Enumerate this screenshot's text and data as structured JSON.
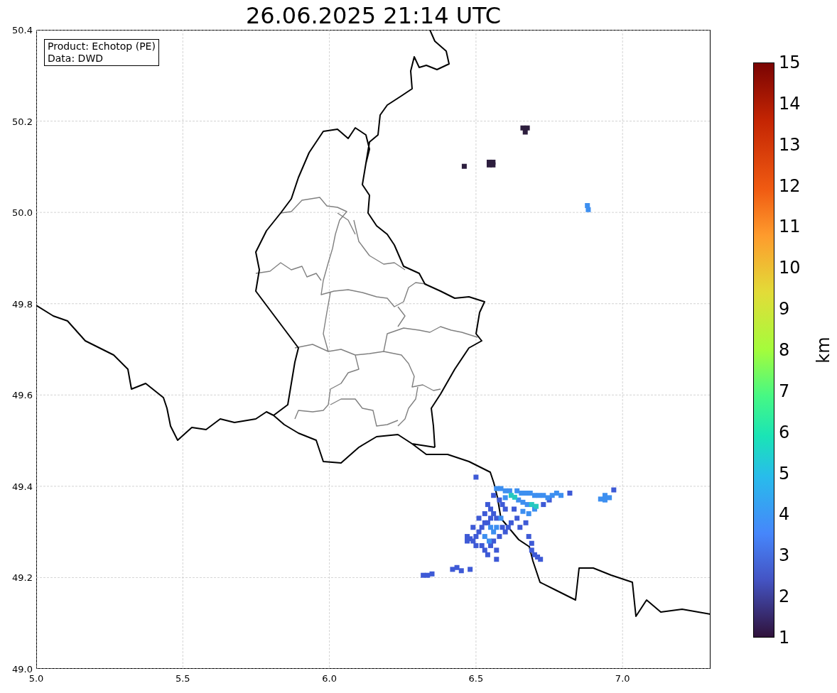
{
  "title": "26.06.2025 21:14 UTC",
  "legend": {
    "lines": [
      "Product: Echotop (PE)",
      "Data: DWD"
    ]
  },
  "map": {
    "x_tick_labels": [
      "5.0",
      "5.5",
      "6.0",
      "6.5",
      "7.0"
    ],
    "y_tick_labels": [
      "50.4",
      "50.2",
      "50.0",
      "49.8",
      "49.6",
      "49.4",
      "49.2",
      "49.0"
    ]
  },
  "colorbar": {
    "label": "km",
    "ticks": [
      "15",
      "14",
      "13",
      "12",
      "11",
      "10",
      "9",
      "8",
      "7",
      "6",
      "5",
      "4",
      "3",
      "2",
      "1"
    ]
  }
}
